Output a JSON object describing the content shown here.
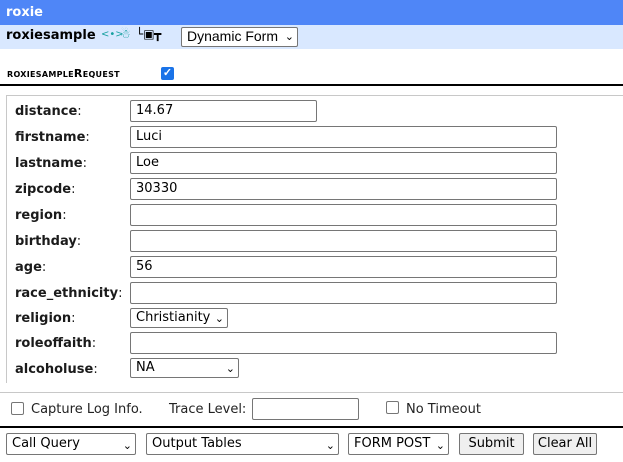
{
  "app": {
    "title": "roxie"
  },
  "service": {
    "name": "roxiesample",
    "icons": [
      "xml-icon",
      "schema-icon",
      "tree-icon",
      "hierarchy-icon"
    ],
    "view_select": "Dynamic Form"
  },
  "request": {
    "title": "roxiesampleRequest",
    "checked": true
  },
  "fields": [
    {
      "label": "distance",
      "value": "14.67",
      "type": "text"
    },
    {
      "label": "firstname",
      "value": "Luci",
      "type": "text"
    },
    {
      "label": "lastname",
      "value": "Loe",
      "type": "text"
    },
    {
      "label": "zipcode",
      "value": "30330",
      "type": "text"
    },
    {
      "label": "region",
      "value": "",
      "type": "text"
    },
    {
      "label": "birthday",
      "value": "",
      "type": "text"
    },
    {
      "label": "age",
      "value": "56",
      "type": "text"
    },
    {
      "label": "race_ethnicity",
      "value": "",
      "type": "text"
    },
    {
      "label": "religion",
      "value": "Christianity",
      "type": "select"
    },
    {
      "label": "roleoffaith",
      "value": "",
      "type": "text"
    },
    {
      "label": "alcoholuse",
      "value": "NA",
      "type": "select"
    }
  ],
  "options": {
    "capture_log": "Capture Log Info.",
    "trace_level": "Trace Level:",
    "trace_value": "",
    "no_timeout": "No Timeout"
  },
  "toolbar": {
    "call_query": "Call Query",
    "output": "Output Tables",
    "method": "FORM POST",
    "submit": "Submit",
    "clear": "Clear All"
  },
  "colors": {
    "title_bar": "#4f86f7",
    "service_bar": "#d9e8ff",
    "checkbox_accent": "#1a73e8"
  }
}
